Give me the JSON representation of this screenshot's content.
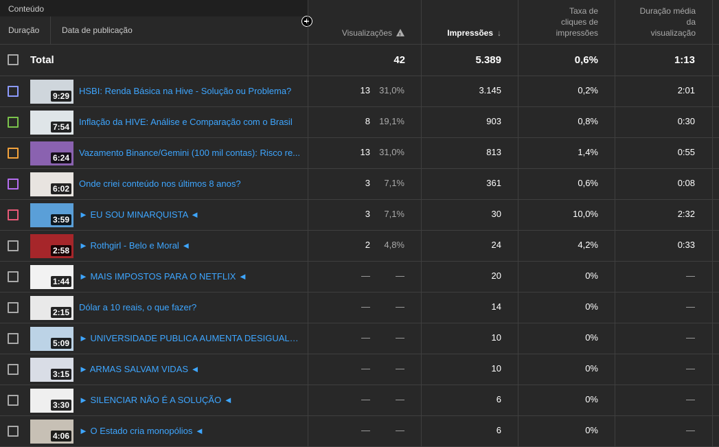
{
  "header": {
    "content_label": "Conteúdo",
    "duration_label": "Duração",
    "date_label": "Data de publicação",
    "views_label": "Visualizações",
    "impressions_label": "Impressões",
    "ctr_label": [
      "Taxa de",
      "cliques de",
      "impressões"
    ],
    "avd_label": [
      "Duração média",
      "da",
      "visualização"
    ]
  },
  "total": {
    "label": "Total",
    "views": "42",
    "impressions": "5.389",
    "ctr": "0,6%",
    "avd": "1:13"
  },
  "colors": {
    "link": "#3ea6ff",
    "bg": "#282828"
  },
  "rows": [
    {
      "color": "#8c9aff",
      "duration": "9:29",
      "title": "HSBI: Renda Básica na Hive - Solução ou Problema?",
      "views": "13",
      "views_pct": "31,0%",
      "impressions": "3.145",
      "ctr": "0,2%",
      "avd": "2:01",
      "thumb": "#cfd6dc"
    },
    {
      "color": "#7bc34b",
      "duration": "7:54",
      "title": "Inflação da HIVE: Análise e Comparação com o Brasil",
      "views": "8",
      "views_pct": "19,1%",
      "impressions": "903",
      "ctr": "0,8%",
      "avd": "0:30",
      "thumb": "#dfe5e8"
    },
    {
      "color": "#f2a23c",
      "duration": "6:24",
      "title": "Vazamento Binance/Gemini (100 mil contas): Risco re...",
      "views": "13",
      "views_pct": "31,0%",
      "impressions": "813",
      "ctr": "1,4%",
      "avd": "0:55",
      "thumb": "#8a62b0"
    },
    {
      "color": "#b56df0",
      "duration": "6:02",
      "title": "Onde criei conteúdo nos últimos 8 anos?",
      "views": "3",
      "views_pct": "7,1%",
      "impressions": "361",
      "ctr": "0,6%",
      "avd": "0:08",
      "thumb": "#e8e4e0"
    },
    {
      "color": "#e85a78",
      "duration": "3:59",
      "title": "► EU SOU MINARQUISTA ◄",
      "views": "3",
      "views_pct": "7,1%",
      "impressions": "30",
      "ctr": "10,0%",
      "avd": "2:32",
      "thumb": "#5a9fd8"
    },
    {
      "color": "#aaaaaa",
      "duration": "2:58",
      "title": "► Rothgirl - Belo e Moral ◄",
      "views": "2",
      "views_pct": "4,8%",
      "impressions": "24",
      "ctr": "4,2%",
      "avd": "0:33",
      "thumb": "#a6262a"
    },
    {
      "color": "#aaaaaa",
      "duration": "1:44",
      "title": "► MAIS IMPOSTOS PARA O NETFLIX ◄",
      "views": "—",
      "views_pct": "—",
      "impressions": "20",
      "ctr": "0%",
      "avd": "—",
      "thumb": "#f2f2f2"
    },
    {
      "color": "#aaaaaa",
      "duration": "2:15",
      "title": "Dólar a 10 reais, o que fazer?",
      "views": "—",
      "views_pct": "—",
      "impressions": "14",
      "ctr": "0%",
      "avd": "—",
      "thumb": "#e9e9e9"
    },
    {
      "color": "#aaaaaa",
      "duration": "5:09",
      "title": "► UNIVERSIDADE PUBLICA AUMENTA DESIGUALDAD...",
      "views": "—",
      "views_pct": "—",
      "impressions": "10",
      "ctr": "0%",
      "avd": "—",
      "thumb": "#bcd3e6"
    },
    {
      "color": "#aaaaaa",
      "duration": "3:15",
      "title": "► ARMAS SALVAM VIDAS ◄",
      "views": "—",
      "views_pct": "—",
      "impressions": "10",
      "ctr": "0%",
      "avd": "—",
      "thumb": "#d9dde6"
    },
    {
      "color": "#aaaaaa",
      "duration": "3:30",
      "title": "► SILENCIAR NÃO É A SOLUÇÃO ◄",
      "views": "—",
      "views_pct": "—",
      "impressions": "6",
      "ctr": "0%",
      "avd": "—",
      "thumb": "#efefef"
    },
    {
      "color": "#aaaaaa",
      "duration": "4:06",
      "title": "► O Estado cria monopólios ◄",
      "views": "—",
      "views_pct": "—",
      "impressions": "6",
      "ctr": "0%",
      "avd": "—",
      "thumb": "#c7c0b5"
    }
  ]
}
